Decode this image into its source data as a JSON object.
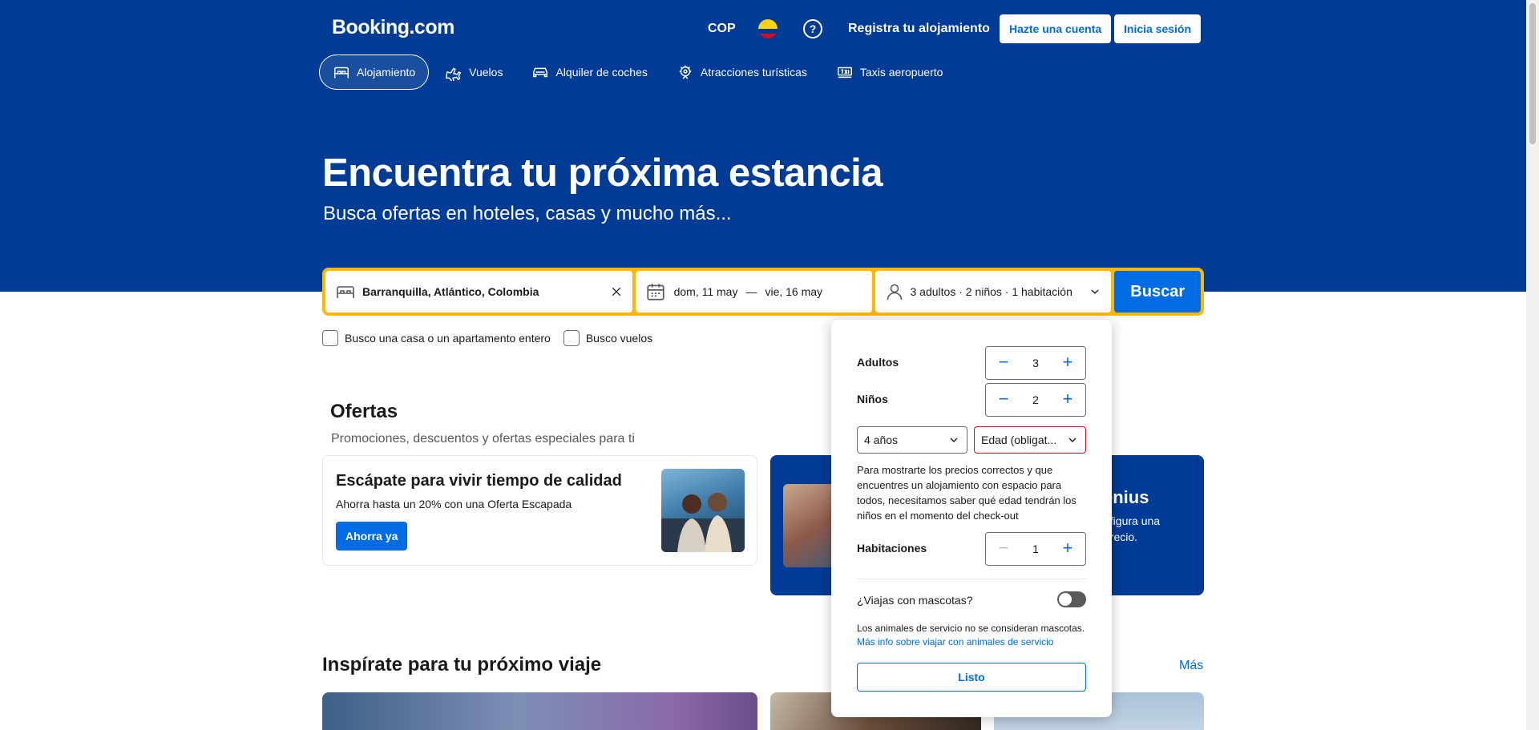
{
  "header": {
    "logo": "Booking.com",
    "currency": "COP",
    "help": "?",
    "list_property": "Registra tu alojamiento",
    "signup": "Hazte una cuenta",
    "signin": "Inicia sesión"
  },
  "nav": {
    "tabs": [
      {
        "label": "Alojamiento",
        "icon": "bed-icon",
        "active": true
      },
      {
        "label": "Vuelos",
        "icon": "plane-icon"
      },
      {
        "label": "Alquiler de coches",
        "icon": "car-icon"
      },
      {
        "label": "Atracciones turísticas",
        "icon": "attractions-icon"
      },
      {
        "label": "Taxis aeropuerto",
        "icon": "taxi-icon"
      }
    ]
  },
  "hero": {
    "title": "Encuentra tu próxima estancia",
    "subtitle": "Busca ofertas en hoteles, casas y mucho más..."
  },
  "search": {
    "destination": "Barranquilla, Atlántico, Colombia",
    "checkin": "dom, 11 may",
    "date_separator": "—",
    "checkout": "vie, 16 may",
    "occupancy": "3 adultos · 2 niños · 1 habitación",
    "button": "Buscar"
  },
  "checkboxes": [
    {
      "label": "Busco una casa o un apartamento entero",
      "checked": false
    },
    {
      "label": "Busco vuelos",
      "checked": false
    }
  ],
  "offers": {
    "title": "Ofertas",
    "subtitle": "Promociones, descuentos y ofertas especiales para ti",
    "card1": {
      "title": "Escápate para vivir tiempo de calidad",
      "text": "Ahorra hasta un 20% con una Oferta Escapada",
      "button": "Ahorra ya"
    },
    "card2": {
      "title": "enius",
      "text_line1": "nfigura una",
      "text_line2": "precio."
    }
  },
  "inspire": {
    "title": "Inspírate para tu próximo viaje",
    "more": "Más"
  },
  "occupancy_popup": {
    "adults_label": "Adultos",
    "adults": "3",
    "children_label": "Niños",
    "children": "2",
    "child_age_1": "4 años",
    "child_age_2": "Edad (obligat...",
    "note": "Para mostrarte los precios correctos y que encuentres un alojamiento con espacio para todos, necesitamos saber qué edad tendrán los niños en el momento del check-out",
    "rooms_label": "Habitaciones",
    "rooms": "1",
    "minus": "−",
    "plus": "+",
    "pets_label": "¿Viajas con mascotas?",
    "pets_on": false,
    "pets_info": "Los animales de servicio no se consideran mascotas.",
    "pets_link": "Más info sobre viajar con animales de servicio",
    "done": "Listo"
  },
  "colors": {
    "brand_blue": "#003b95",
    "action_blue": "#006ce4",
    "search_border": "#ffb700",
    "error_red": "#d4111e"
  }
}
